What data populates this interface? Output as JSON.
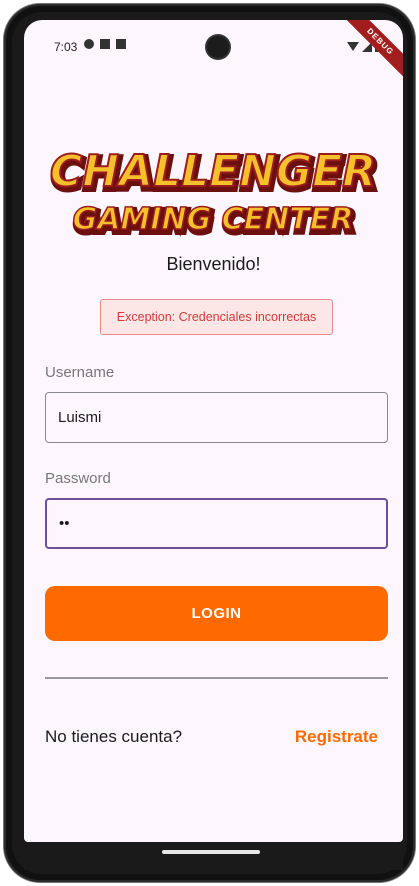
{
  "status_bar": {
    "time": "7:03",
    "left_icons": [
      "shield-icon",
      "sd-card-icon",
      "android-icon"
    ],
    "right_icons": [
      "wifi-icon",
      "signal-icon",
      "battery-icon"
    ]
  },
  "debug_banner": "DEBUG",
  "logo": {
    "line1": "CHALLENGER",
    "line2": "GAMING CENTER",
    "colors": {
      "fill": "#f6c02d",
      "outline": "#9b1c1c",
      "highlight": "#fff4a8"
    }
  },
  "welcome_text": "Bienvenido!",
  "error_message": "Exception: Credenciales incorrectas",
  "form": {
    "username_label": "Username",
    "username_value": "Luismi",
    "password_label": "Password",
    "password_value": "••"
  },
  "login_button": "LOGIN",
  "footer": {
    "prompt": "No tienes cuenta?",
    "register_link": "Registrate"
  },
  "colors": {
    "accent": "#ff6a00",
    "error_bg": "#fde6e6",
    "error_text": "#d33a3a",
    "focus_border": "#6a4f9a",
    "screen_bg": "#fdf7fd"
  }
}
